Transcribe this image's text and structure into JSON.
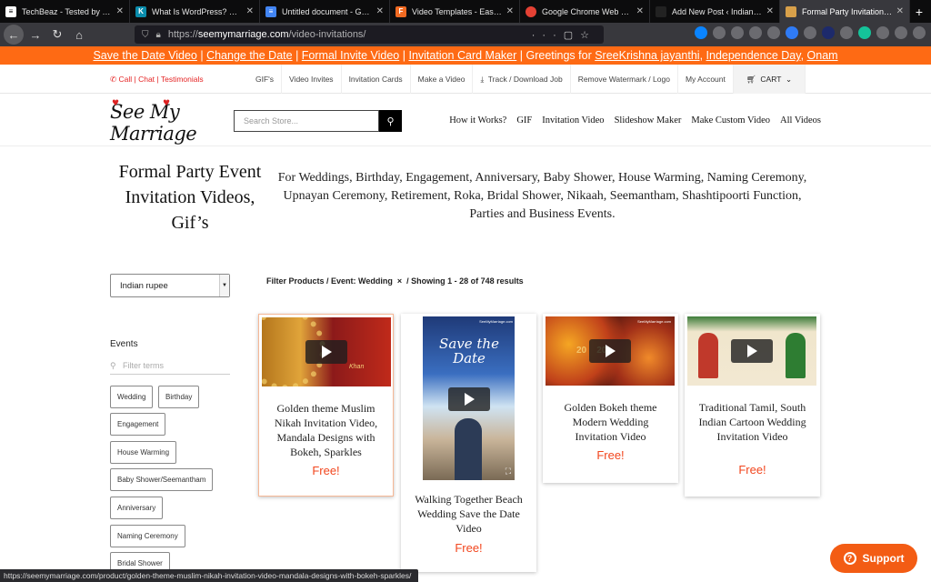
{
  "tabs": [
    {
      "title": "TechBeaz - Tested by us, w",
      "color": "#ffffff",
      "glyph": "",
      "active": false
    },
    {
      "title": "What Is WordPress? Explai",
      "color": "#0a8cac",
      "glyph": "K",
      "active": false
    },
    {
      "title": "Untitled document - Googl",
      "color": "#4285f4",
      "glyph": "≡",
      "active": false
    },
    {
      "title": "Video Templates - Easily M",
      "color": "#f06a22",
      "glyph": "F",
      "active": false
    },
    {
      "title": "Google Chrome Web Brow",
      "color": "#e44134",
      "glyph": "●",
      "active": false
    },
    {
      "title": "Add New Post ‹ IndianWed",
      "color": "#222222",
      "glyph": "",
      "active": false
    },
    {
      "title": "Formal Party Invitation Vide",
      "color": "#d8a04a",
      "glyph": "▣",
      "active": true
    }
  ],
  "url": {
    "prefix": "https://",
    "domain": "seemymarriage.com",
    "path": "/video-invitations/"
  },
  "promo": {
    "links": [
      "Save the Date Video",
      "Change the Date",
      "Formal Invite Video",
      "Invitation Card Maker"
    ],
    "greeting": "| Greetings for ",
    "name": "SreeKrishna jayanthi",
    "day1": "Independence Day",
    "day2": "Onam"
  },
  "topnav": {
    "call": "Call",
    "chat": "Chat",
    "testimonials": "Testimonials",
    "links": [
      "GIF's",
      "Video Invites",
      "Invitation Cards",
      "Make a Video",
      "Track / Download Job",
      "Remove Watermark / Logo",
      "My Account"
    ],
    "cart": "CART"
  },
  "header": {
    "logo": "See My Marriage",
    "search_placeholder": "Search Store...",
    "menu": [
      "How it Works?",
      "GIF",
      "Invitation Video",
      "Slideshow Maker",
      "Make Custom Video",
      "All Videos"
    ]
  },
  "page": {
    "title": "Formal Party Event Invitation Videos, Gif’s",
    "description": "For Weddings, Birthday, Engagement, Anniversary, Baby Shower, House Warming, Naming Ceremony, Upnayan Ceremony, Retirement, Roka, Bridal Shower, Nikaah, Seemantham, Shashtipoorti Function, Parties and Business Events."
  },
  "sidebar": {
    "currency": "Indian rupee",
    "events_label": "Events",
    "filter_placeholder": "Filter terms",
    "chips": [
      "Wedding",
      "Birthday",
      "Engagement",
      "House Warming",
      "Baby Shower/Seemantham",
      "Anniversary",
      "Naming Ceremony",
      "Bridal Shower"
    ]
  },
  "filter": {
    "prefix": "Filter Products / Event: Wedding",
    "x": "×",
    "suffix": "/ Showing 1 - 28 of 748 results"
  },
  "products": [
    {
      "title": "Golden theme Muslim Nikah Invitation Video, Mandala Designs with Bokeh, Sparkles",
      "price": "Free!"
    },
    {
      "title": "Walking Together Beach Wedding Save the Date Video",
      "price": "Free!"
    },
    {
      "title": "Golden Bokeh theme Modern Wedding Invitation Video",
      "price": "Free!"
    },
    {
      "title": "Traditional Tamil, South Indian Cartoon Wedding Invitation Video",
      "price": "Free!"
    }
  ],
  "thumbtext": {
    "save": "Save the Date",
    "url": "SeeMyMarriage.com",
    "khan": "Khan",
    "year": "20    20"
  },
  "status_url": "https://seemymarriage.com/product/golden-theme-muslim-nikah-invitation-video-mandala-designs-with-bokeh-sparkles/",
  "support": "Support",
  "colors": {
    "accent": "#fe6a14",
    "price": "#f2461e"
  }
}
